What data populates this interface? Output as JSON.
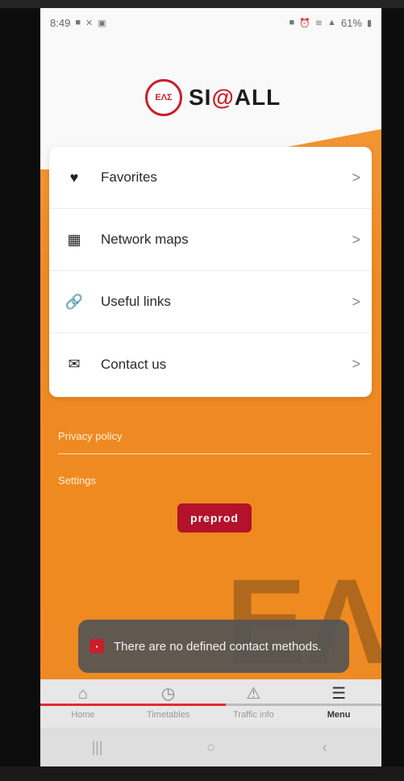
{
  "status_bar": {
    "time": "8:49",
    "battery": "61%"
  },
  "brand": {
    "logo_mark": "ΕΛΣ",
    "name_prefix": "SI",
    "name_at": "@",
    "name_suffix": "ALL",
    "accent_color": "#c81f2a",
    "primary_color": "#ef8b24"
  },
  "menu": {
    "items": [
      {
        "label": "Favorites",
        "icon": "heart-icon"
      },
      {
        "label": "Network maps",
        "icon": "map-icon"
      },
      {
        "label": "Useful links",
        "icon": "link-icon"
      },
      {
        "label": "Contact us",
        "icon": "envelope-icon"
      }
    ],
    "chevron": ">"
  },
  "links": {
    "privacy": "Privacy policy",
    "settings": "Settings"
  },
  "env_badge": "preprod",
  "toast": {
    "message": "There are no defined contact methods."
  },
  "video_progress": 0.55,
  "bottom_nav": {
    "items": [
      {
        "label": "Home",
        "icon": "home-icon"
      },
      {
        "label": "Timetables",
        "icon": "clock-icon"
      },
      {
        "label": "Traffic info",
        "icon": "warning-icon"
      },
      {
        "label": "Menu",
        "icon": "menu-icon"
      }
    ],
    "active": "Menu"
  },
  "system_nav": {
    "recents": "|||",
    "home": "○",
    "back": "‹"
  }
}
